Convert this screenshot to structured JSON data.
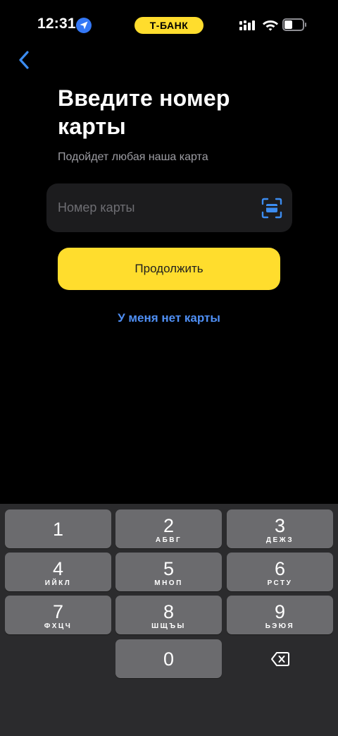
{
  "status_bar": {
    "time": "12:31",
    "carrier": "Т-БАНК",
    "icons": [
      "location-arrow-icon",
      "signal-icon",
      "wifi-icon",
      "battery-icon"
    ]
  },
  "header": {
    "back_icon": "chevron-left-icon"
  },
  "main": {
    "title": "Введите номер карты",
    "subtitle": "Подойдет любая наша карта",
    "card_input": {
      "placeholder": "Номер карты",
      "value": "",
      "icon": "card-scan-icon"
    },
    "continue_label": "Продолжить",
    "no_card_label": "У меня нет карты"
  },
  "keyboard": {
    "keys": [
      {
        "digit": "1",
        "letters": ""
      },
      {
        "digit": "2",
        "letters": "АБВГ"
      },
      {
        "digit": "3",
        "letters": "ДЕЖЗ"
      },
      {
        "digit": "4",
        "letters": "ИЙКЛ"
      },
      {
        "digit": "5",
        "letters": "МНОП"
      },
      {
        "digit": "6",
        "letters": "РСТУ"
      },
      {
        "digit": "7",
        "letters": "ФХЦЧ"
      },
      {
        "digit": "8",
        "letters": "ШЩЪЫ"
      },
      {
        "digit": "9",
        "letters": "ЬЭЮЯ"
      },
      {
        "digit": "0",
        "letters": ""
      }
    ],
    "delete_icon": "backspace-icon"
  },
  "colors": {
    "background": "#000000",
    "accent_yellow": "#ffdd2d",
    "link_blue": "#4f8ff4",
    "field_bg": "#1c1c1e",
    "keyboard_bg": "#2b2b2d",
    "key_bg": "#6b6b6e"
  }
}
